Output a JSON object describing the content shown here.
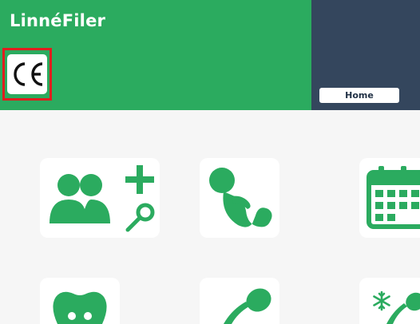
{
  "header": {
    "app_title": "LinnéFiler",
    "ce_logo_text": "CE"
  },
  "nav": {
    "home_label": "Home"
  },
  "tiles": [
    {
      "icon": "patient-search-icon"
    },
    {
      "icon": "fetus-icon"
    },
    {
      "icon": "calendar-icon"
    },
    {
      "icon": "uterus-icon"
    },
    {
      "icon": "sperm-icon"
    },
    {
      "icon": "frozen-sperm-icon"
    }
  ],
  "colors": {
    "brand_green": "#2bab5f",
    "panel_navy": "#34465d",
    "highlight_red": "#e01e1e",
    "background": "#f6f6f6"
  }
}
